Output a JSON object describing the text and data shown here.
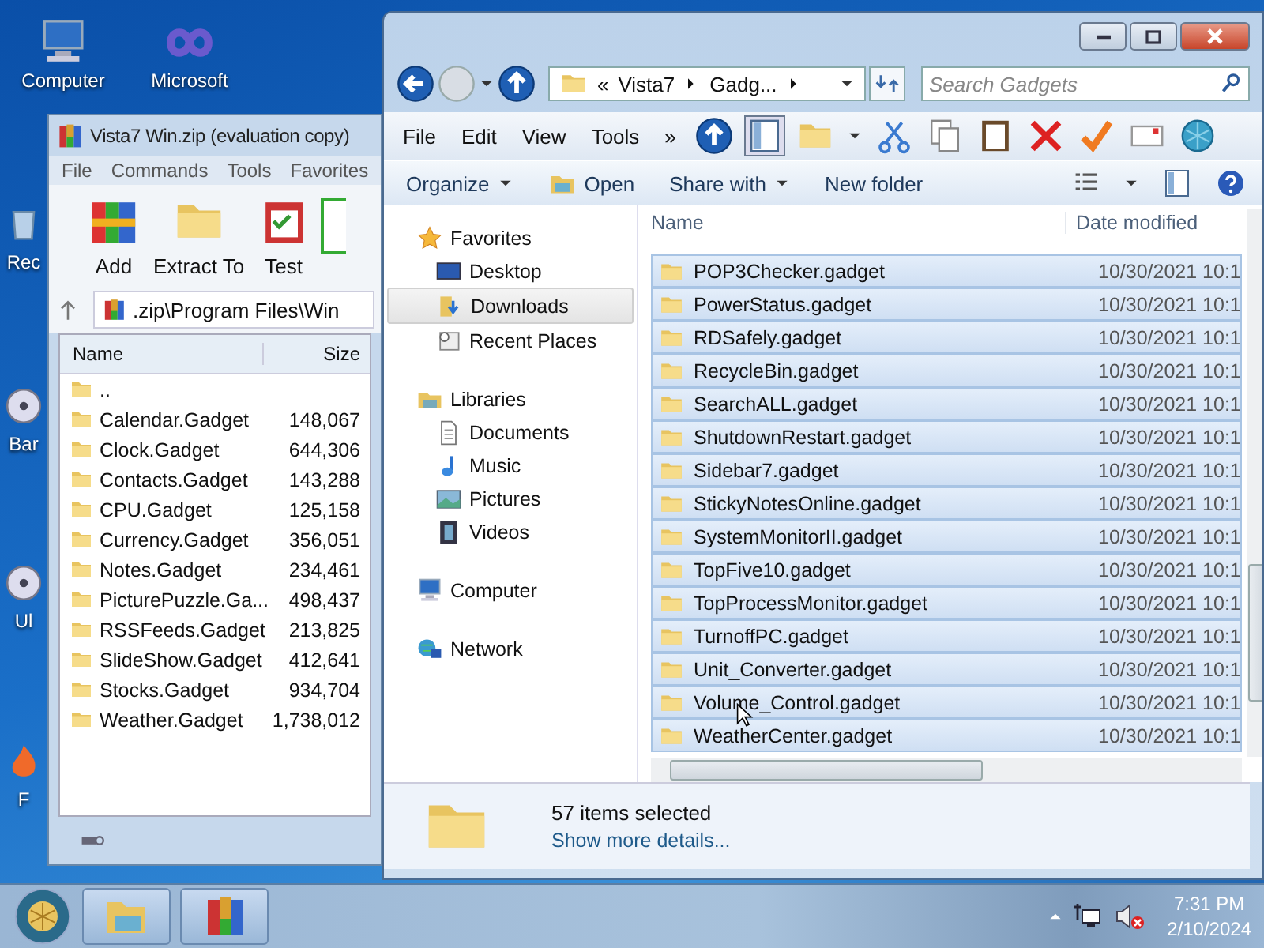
{
  "desktop": {
    "icons": [
      {
        "label": "Computer",
        "kind": "computer"
      },
      {
        "label": "Microsoft",
        "kind": "infinity"
      },
      {
        "label": "Rec",
        "kind": "bin"
      },
      {
        "label": "Bar",
        "kind": "disc"
      },
      {
        "label": "Ul",
        "kind": "disc"
      },
      {
        "label": "F",
        "kind": "fire"
      }
    ]
  },
  "archiver": {
    "title": "Vista7 Win.zip (evaluation copy)",
    "menu": [
      "File",
      "Commands",
      "Tools",
      "Favorites"
    ],
    "toolbar": [
      {
        "label": "Add",
        "kind": "books"
      },
      {
        "label": "Extract To",
        "kind": "folder"
      },
      {
        "label": "Test",
        "kind": "clipboard"
      }
    ],
    "path": ".zip\\Program Files\\Win",
    "columns": [
      "Name",
      "Size"
    ],
    "rows": [
      {
        "name": ".."
      },
      {
        "name": "Calendar.Gadget",
        "size": "148,067"
      },
      {
        "name": "Clock.Gadget",
        "size": "644,306"
      },
      {
        "name": "Contacts.Gadget",
        "size": "143,288"
      },
      {
        "name": "CPU.Gadget",
        "size": "125,158"
      },
      {
        "name": "Currency.Gadget",
        "size": "356,051"
      },
      {
        "name": "Notes.Gadget",
        "size": "234,461"
      },
      {
        "name": "PicturePuzzle.Ga...",
        "size": "498,437"
      },
      {
        "name": "RSSFeeds.Gadget",
        "size": "213,825"
      },
      {
        "name": "SlideShow.Gadget",
        "size": "412,641"
      },
      {
        "name": "Stocks.Gadget",
        "size": "934,704"
      },
      {
        "name": "Weather.Gadget",
        "size": "1,738,012"
      }
    ]
  },
  "explorer": {
    "breadcrumb": [
      "«",
      "Vista7",
      "Gadg..."
    ],
    "search": {
      "placeholder": "Search Gadgets"
    },
    "menu": [
      "File",
      "Edit",
      "View",
      "Tools",
      "»"
    ],
    "commands": [
      {
        "label": "Organize",
        "kind": "menu"
      },
      {
        "label": "Open",
        "kind": "open"
      },
      {
        "label": "Share with",
        "kind": "menu"
      },
      {
        "label": "New folder",
        "kind": "plain"
      }
    ],
    "nav": [
      {
        "label": "Favorites",
        "kind": "star",
        "children": [
          {
            "label": "Desktop",
            "kind": "desktop",
            "selected": false
          },
          {
            "label": "Downloads",
            "kind": "download",
            "selected": true
          },
          {
            "label": "Recent Places",
            "kind": "recent",
            "selected": false
          }
        ]
      },
      {
        "label": "Libraries",
        "kind": "library",
        "children": [
          {
            "label": "Documents",
            "kind": "document",
            "selected": false
          },
          {
            "label": "Music",
            "kind": "music",
            "selected": false
          },
          {
            "label": "Pictures",
            "kind": "picture",
            "selected": false
          },
          {
            "label": "Videos",
            "kind": "video",
            "selected": false
          }
        ]
      },
      {
        "label": "Computer",
        "kind": "computer"
      },
      {
        "label": "Network",
        "kind": "network"
      }
    ],
    "columns": [
      "Name",
      "Date modified"
    ],
    "rows": [
      {
        "name": "POP3Checker.gadget",
        "date": "10/30/2021 10:1",
        "selected": true
      },
      {
        "name": "PowerStatus.gadget",
        "date": "10/30/2021 10:1",
        "selected": true
      },
      {
        "name": "RDSafely.gadget",
        "date": "10/30/2021 10:1",
        "selected": true
      },
      {
        "name": "RecycleBin.gadget",
        "date": "10/30/2021 10:1",
        "selected": true
      },
      {
        "name": "SearchALL.gadget",
        "date": "10/30/2021 10:1",
        "selected": true
      },
      {
        "name": "ShutdownRestart.gadget",
        "date": "10/30/2021 10:1",
        "selected": true
      },
      {
        "name": "Sidebar7.gadget",
        "date": "10/30/2021 10:1",
        "selected": true
      },
      {
        "name": "StickyNotesOnline.gadget",
        "date": "10/30/2021 10:1",
        "selected": true
      },
      {
        "name": "SystemMonitorII.gadget",
        "date": "10/30/2021 10:1",
        "selected": true
      },
      {
        "name": "TopFive10.gadget",
        "date": "10/30/2021 10:1",
        "selected": true
      },
      {
        "name": "TopProcessMonitor.gadget",
        "date": "10/30/2021 10:1",
        "selected": true
      },
      {
        "name": "TurnoffPC.gadget",
        "date": "10/30/2021 10:1",
        "selected": true
      },
      {
        "name": "Unit_Converter.gadget",
        "date": "10/30/2021 10:1",
        "selected": true
      },
      {
        "name": "Volume_Control.gadget",
        "date": "10/30/2021 10:1",
        "selected": true
      },
      {
        "name": "WeatherCenter.gadget",
        "date": "10/30/2021 10:1",
        "selected": true
      }
    ],
    "details": {
      "count": "57 items selected",
      "link": "Show more details..."
    }
  },
  "taskbar": {
    "buttons": [
      {
        "kind": "explorer"
      },
      {
        "kind": "archiver"
      }
    ],
    "time": "7:31 PM",
    "date": "2/10/2024"
  }
}
